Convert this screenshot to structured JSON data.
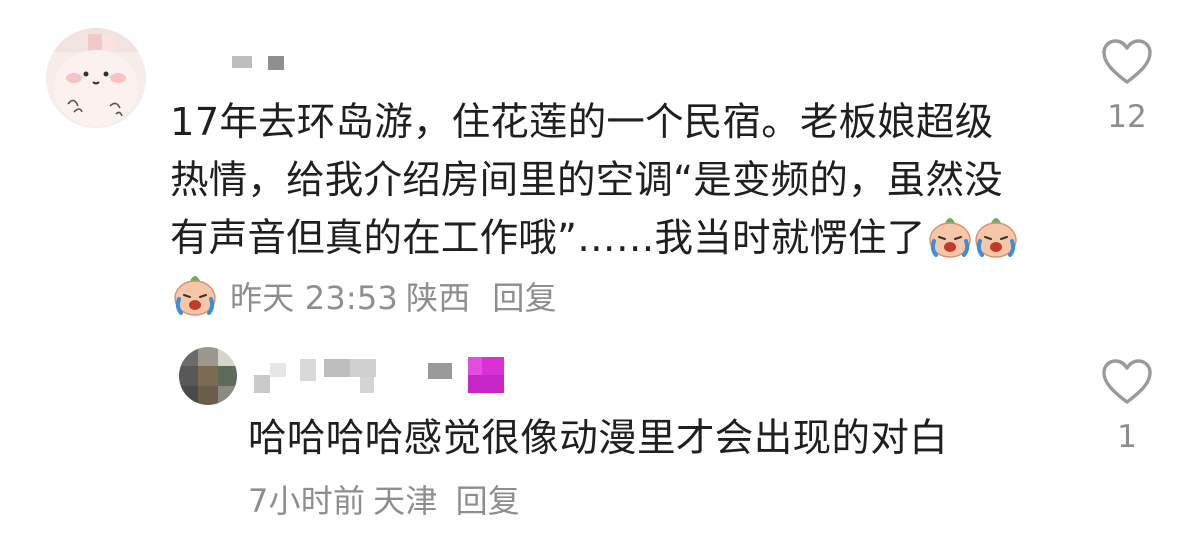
{
  "comment": {
    "text": "17年去环岛游，住花莲的一个民宿。老板娘超级热情，给我介绍房间里的空调“是变频的，虽然没有声音但真的在工作哦”……我当时就愣住了",
    "emoji_icons": [
      "crying-peach-emoji",
      "crying-peach-emoji",
      "crying-peach-emoji"
    ],
    "time": "昨天 23:53",
    "location": "陕西",
    "reply_label": "回复",
    "likes": "12"
  },
  "reply": {
    "text": "哈哈哈哈感觉很像动漫里才会出现的对白",
    "time": "7小时前",
    "location": "天津",
    "reply_label": "回复",
    "likes": "1"
  },
  "colors": {
    "text": "#1f1f1f",
    "meta": "#8e8e8e",
    "icon": "#9a9a9a"
  }
}
